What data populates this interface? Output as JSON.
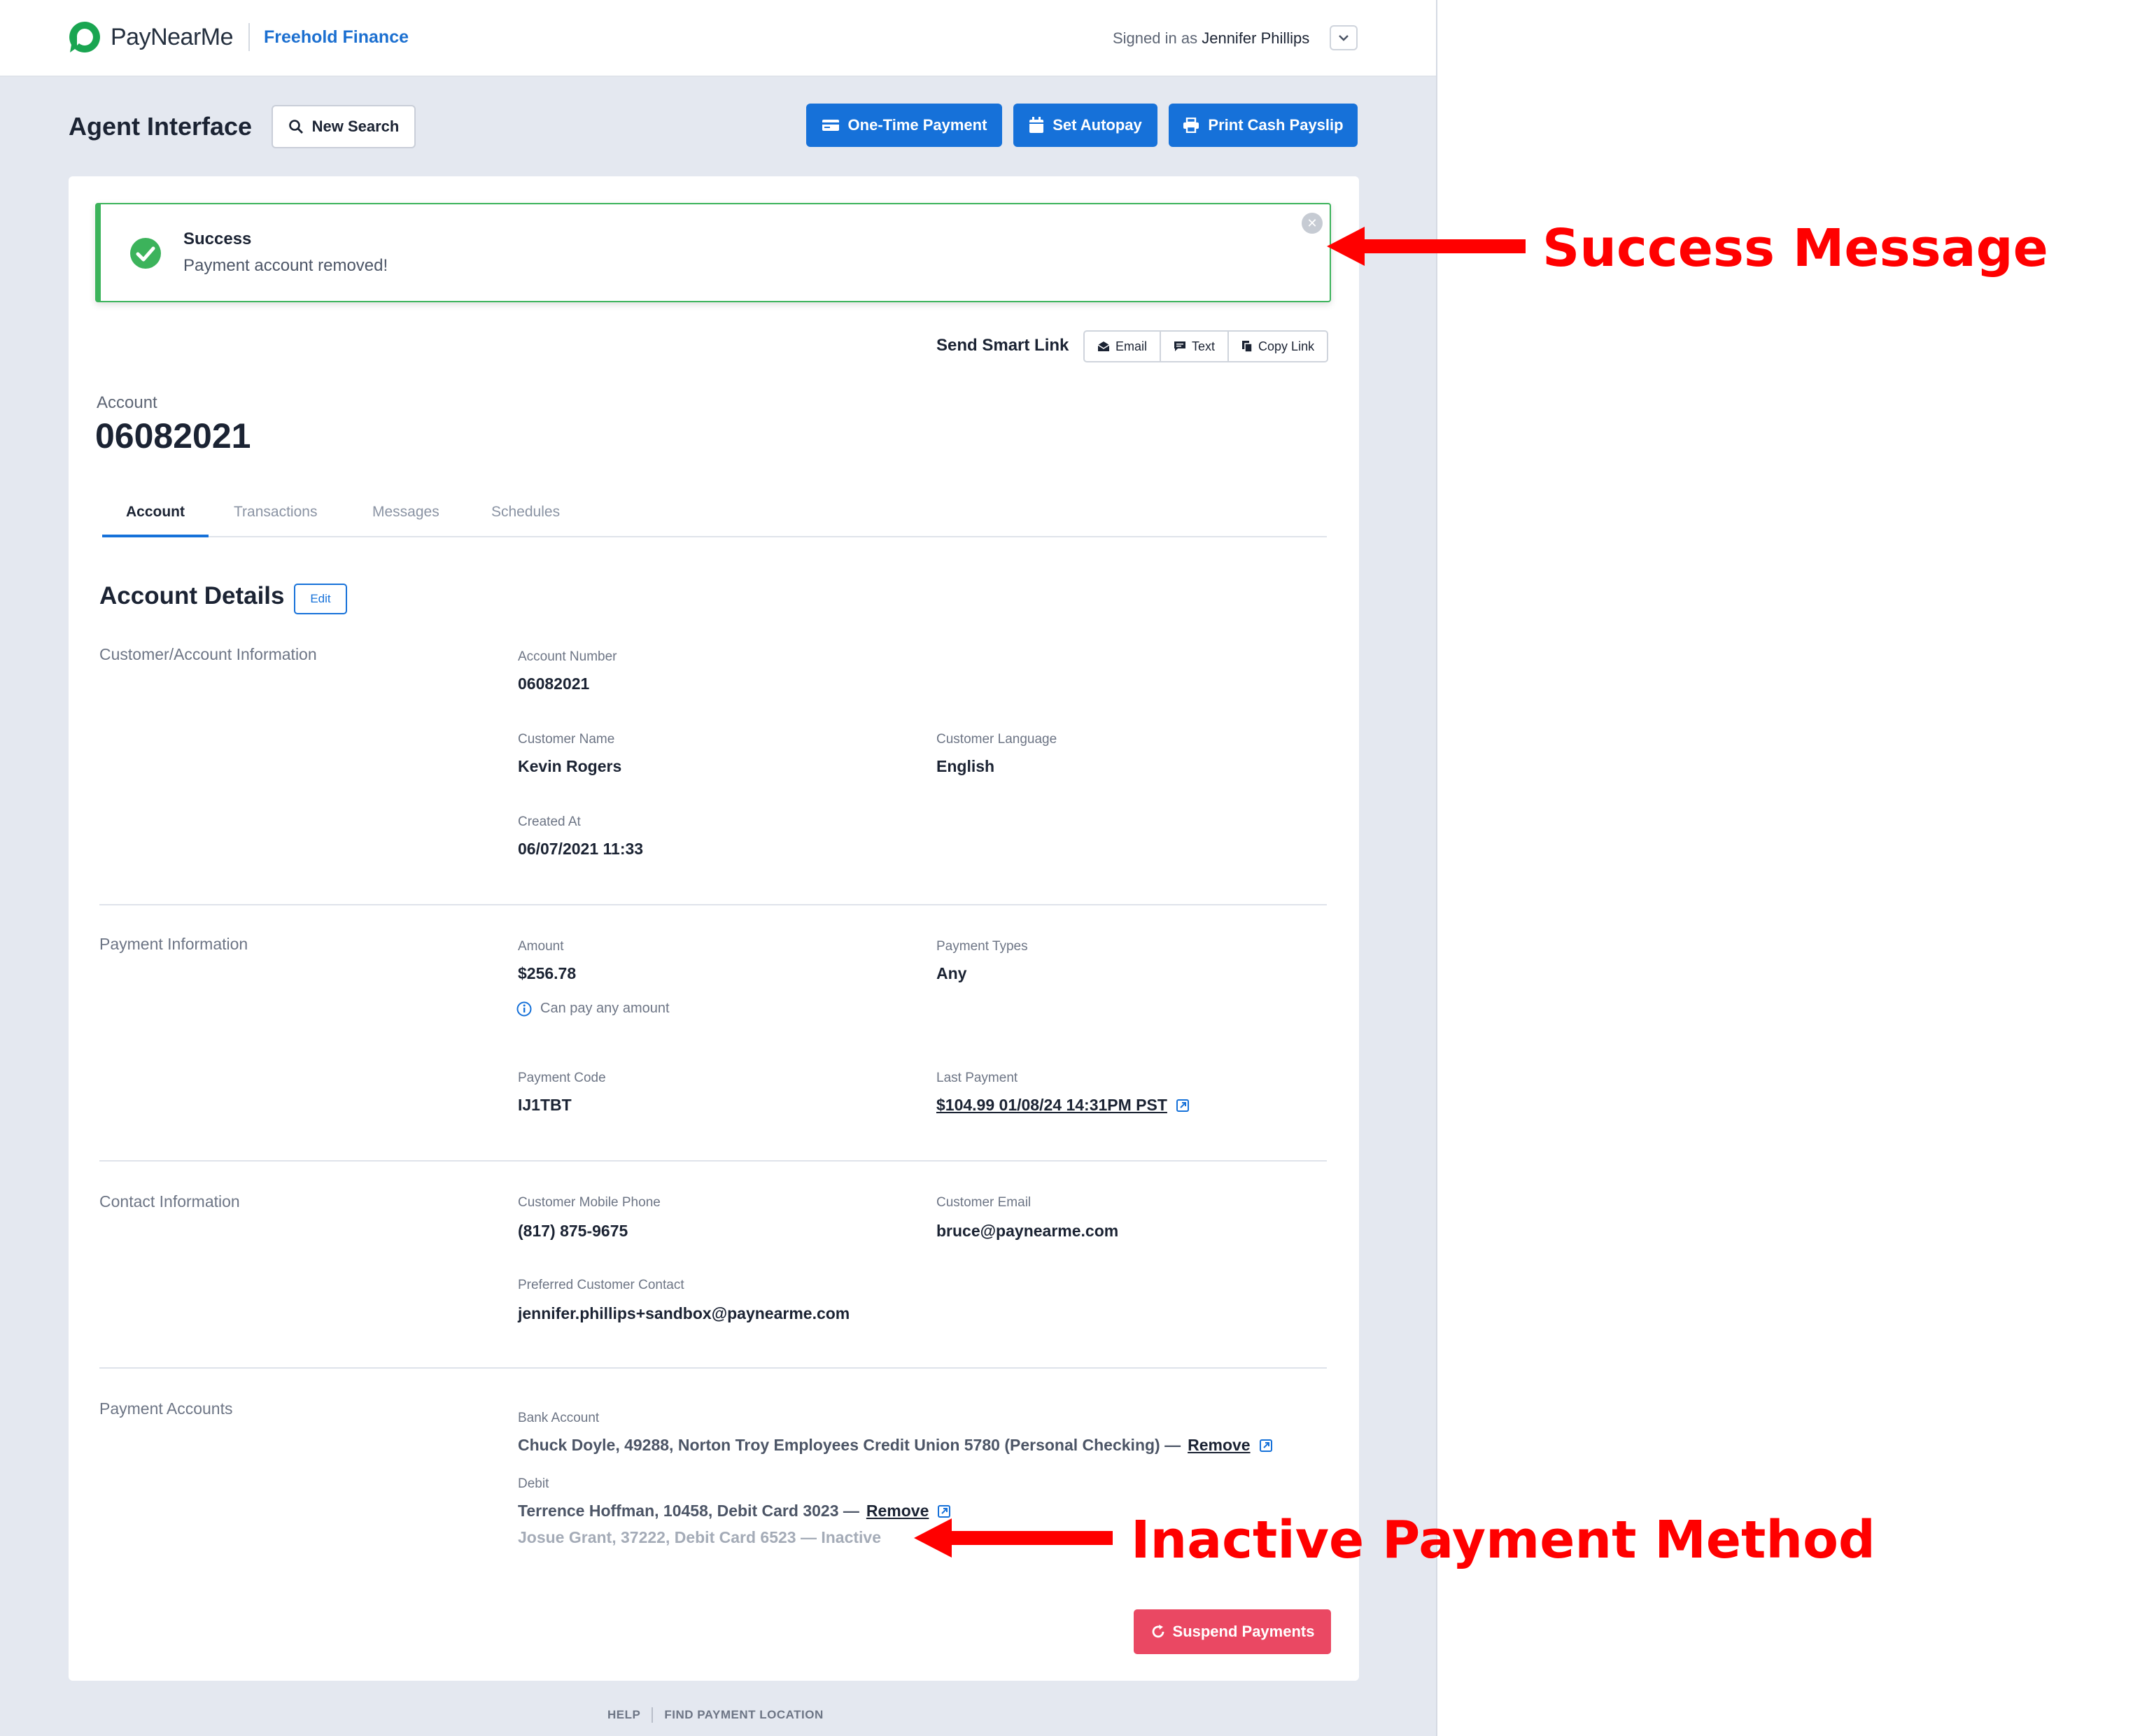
{
  "header": {
    "brand": "PayNearMe",
    "org": "Freehold Finance",
    "signed_prefix": "Signed in as",
    "user": "Jennifer Phillips"
  },
  "toolbar": {
    "title": "Agent Interface",
    "new_search": "New Search",
    "one_time_payment": "One-Time Payment",
    "set_autopay": "Set Autopay",
    "print_cash_payslip": "Print Cash Payslip"
  },
  "alert": {
    "title": "Success",
    "message": "Payment account removed!"
  },
  "smart_link": {
    "label": "Send Smart Link",
    "email": "Email",
    "text": "Text",
    "copy": "Copy Link"
  },
  "account": {
    "label": "Account",
    "number": "06082021"
  },
  "tabs": [
    "Account",
    "Transactions",
    "Messages",
    "Schedules"
  ],
  "details": {
    "title": "Account Details",
    "edit": "Edit",
    "customer_section": {
      "title": "Customer/Account Information",
      "account_number_label": "Account Number",
      "account_number": "06082021",
      "customer_name_label": "Customer Name",
      "customer_name": "Kevin Rogers",
      "customer_language_label": "Customer Language",
      "customer_language": "English",
      "created_at_label": "Created At",
      "created_at": "06/07/2021 11:33"
    },
    "payment_section": {
      "title": "Payment Information",
      "amount_label": "Amount",
      "amount": "$256.78",
      "amount_hint": "Can pay any amount",
      "payment_types_label": "Payment Types",
      "payment_types": "Any",
      "payment_code_label": "Payment Code",
      "payment_code": "IJ1TBT",
      "last_payment_label": "Last Payment",
      "last_payment": "$104.99 01/08/24 14:31PM PST"
    },
    "contact_section": {
      "title": "Contact Information",
      "mobile_label": "Customer Mobile Phone",
      "mobile": "(817) 875-9675",
      "email_label": "Customer Email",
      "email": "bruce@paynearme.com",
      "preferred_label": "Preferred Customer Contact",
      "preferred": "jennifer.phillips+sandbox@paynearme.com"
    },
    "payment_accounts": {
      "title": "Payment Accounts",
      "bank_label": "Bank Account",
      "bank_line": "Chuck Doyle, 49288, Norton Troy Employees Credit Union 5780 (Personal Checking) —",
      "bank_remove": "Remove",
      "debit_label": "Debit",
      "debit_line1": "Terrence Hoffman, 10458, Debit Card 3023 —",
      "debit_remove": "Remove",
      "debit_line2": "Josue Grant, 37222, Debit Card 6523 — Inactive"
    },
    "suspend": "Suspend Payments"
  },
  "footer": {
    "help": "HELP",
    "find": "FIND PAYMENT LOCATION"
  },
  "annotations": {
    "success": "Success Message",
    "inactive": "Inactive Payment Method"
  },
  "colors": {
    "primary": "#1671d9",
    "success": "#3cb35b",
    "danger": "#ea4863",
    "annotation": "#ff0000",
    "brand_green": "#1aa551"
  }
}
